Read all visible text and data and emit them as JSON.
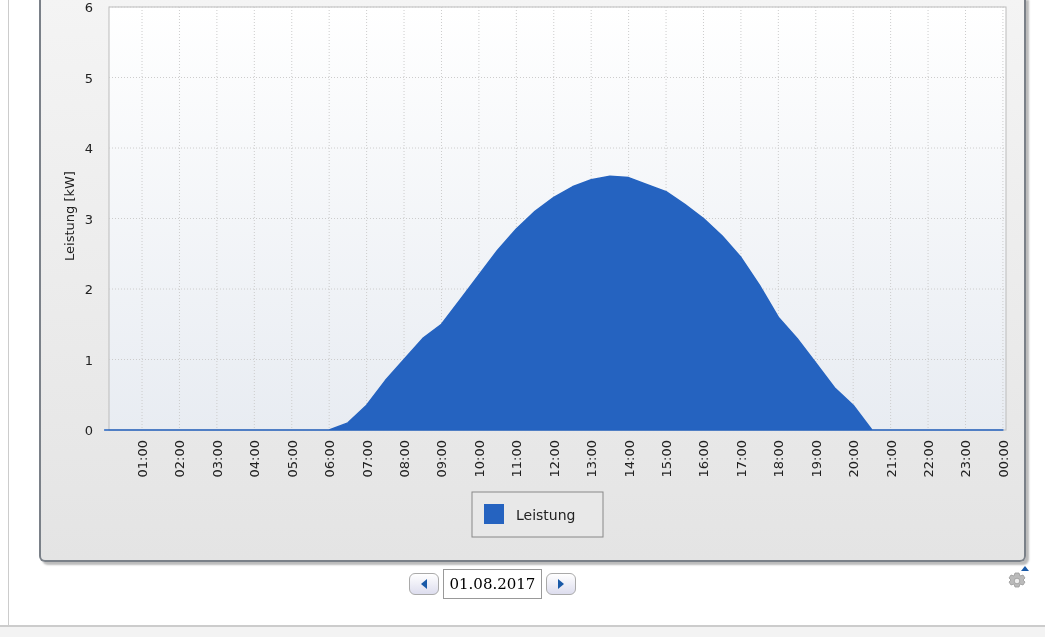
{
  "chart": {
    "chart_data": {
      "type": "area",
      "ylabel": "Leistung [kW]",
      "x": [
        0,
        0.5,
        1,
        1.5,
        2,
        2.5,
        3,
        3.5,
        4,
        4.5,
        5,
        5.5,
        6,
        6.5,
        7,
        7.5,
        8,
        8.5,
        9,
        9.5,
        10,
        10.5,
        11,
        11.5,
        12,
        12.5,
        13,
        13.5,
        14,
        14.5,
        15,
        15.5,
        16,
        16.5,
        17,
        17.5,
        18,
        18.5,
        19,
        19.5,
        20,
        20.5,
        21,
        21.5,
        22,
        22.5,
        23,
        23.5,
        24
      ],
      "series": [
        {
          "name": "Leistung",
          "color": "#2563c0",
          "values": [
            0,
            0,
            0,
            0,
            0,
            0,
            0,
            0,
            0,
            0,
            0,
            0,
            0,
            0.1,
            0.35,
            0.7,
            1.0,
            1.3,
            1.5,
            1.85,
            2.2,
            2.55,
            2.85,
            3.1,
            3.3,
            3.45,
            3.55,
            3.6,
            3.58,
            3.48,
            3.38,
            3.2,
            3.0,
            2.75,
            2.45,
            2.05,
            1.6,
            1.3,
            0.95,
            0.6,
            0.35,
            0,
            0,
            0,
            0,
            0,
            0,
            0,
            0
          ]
        }
      ],
      "xlim": [
        0,
        24
      ],
      "grid": true,
      "ylim": [
        0,
        6
      ],
      "yticks": [
        0,
        1,
        2,
        3,
        4,
        5,
        6
      ],
      "xticks": [
        {
          "value": 1,
          "label": "01:00"
        },
        {
          "value": 2,
          "label": "02:00"
        },
        {
          "value": 3,
          "label": "03:00"
        },
        {
          "value": 4,
          "label": "04:00"
        },
        {
          "value": 5,
          "label": "05:00"
        },
        {
          "value": 6,
          "label": "06:00"
        },
        {
          "value": 7,
          "label": "07:00"
        },
        {
          "value": 8,
          "label": "08:00"
        },
        {
          "value": 9,
          "label": "09:00"
        },
        {
          "value": 10,
          "label": "10:00"
        },
        {
          "value": 11,
          "label": "11:00"
        },
        {
          "value": 12,
          "label": "12:00"
        },
        {
          "value": 13,
          "label": "13:00"
        },
        {
          "value": 14,
          "label": "14:00"
        },
        {
          "value": 15,
          "label": "15:00"
        },
        {
          "value": 16,
          "label": "16:00"
        },
        {
          "value": 17,
          "label": "17:00"
        },
        {
          "value": 18,
          "label": "18:00"
        },
        {
          "value": 19,
          "label": "19:00"
        },
        {
          "value": 20,
          "label": "20:00"
        },
        {
          "value": 21,
          "label": "21:00"
        },
        {
          "value": 22,
          "label": "22:00"
        },
        {
          "value": 23,
          "label": "23:00"
        },
        {
          "value": 24,
          "label": "00:00"
        }
      ]
    }
  },
  "date_nav": {
    "date": "01.08.2017"
  }
}
